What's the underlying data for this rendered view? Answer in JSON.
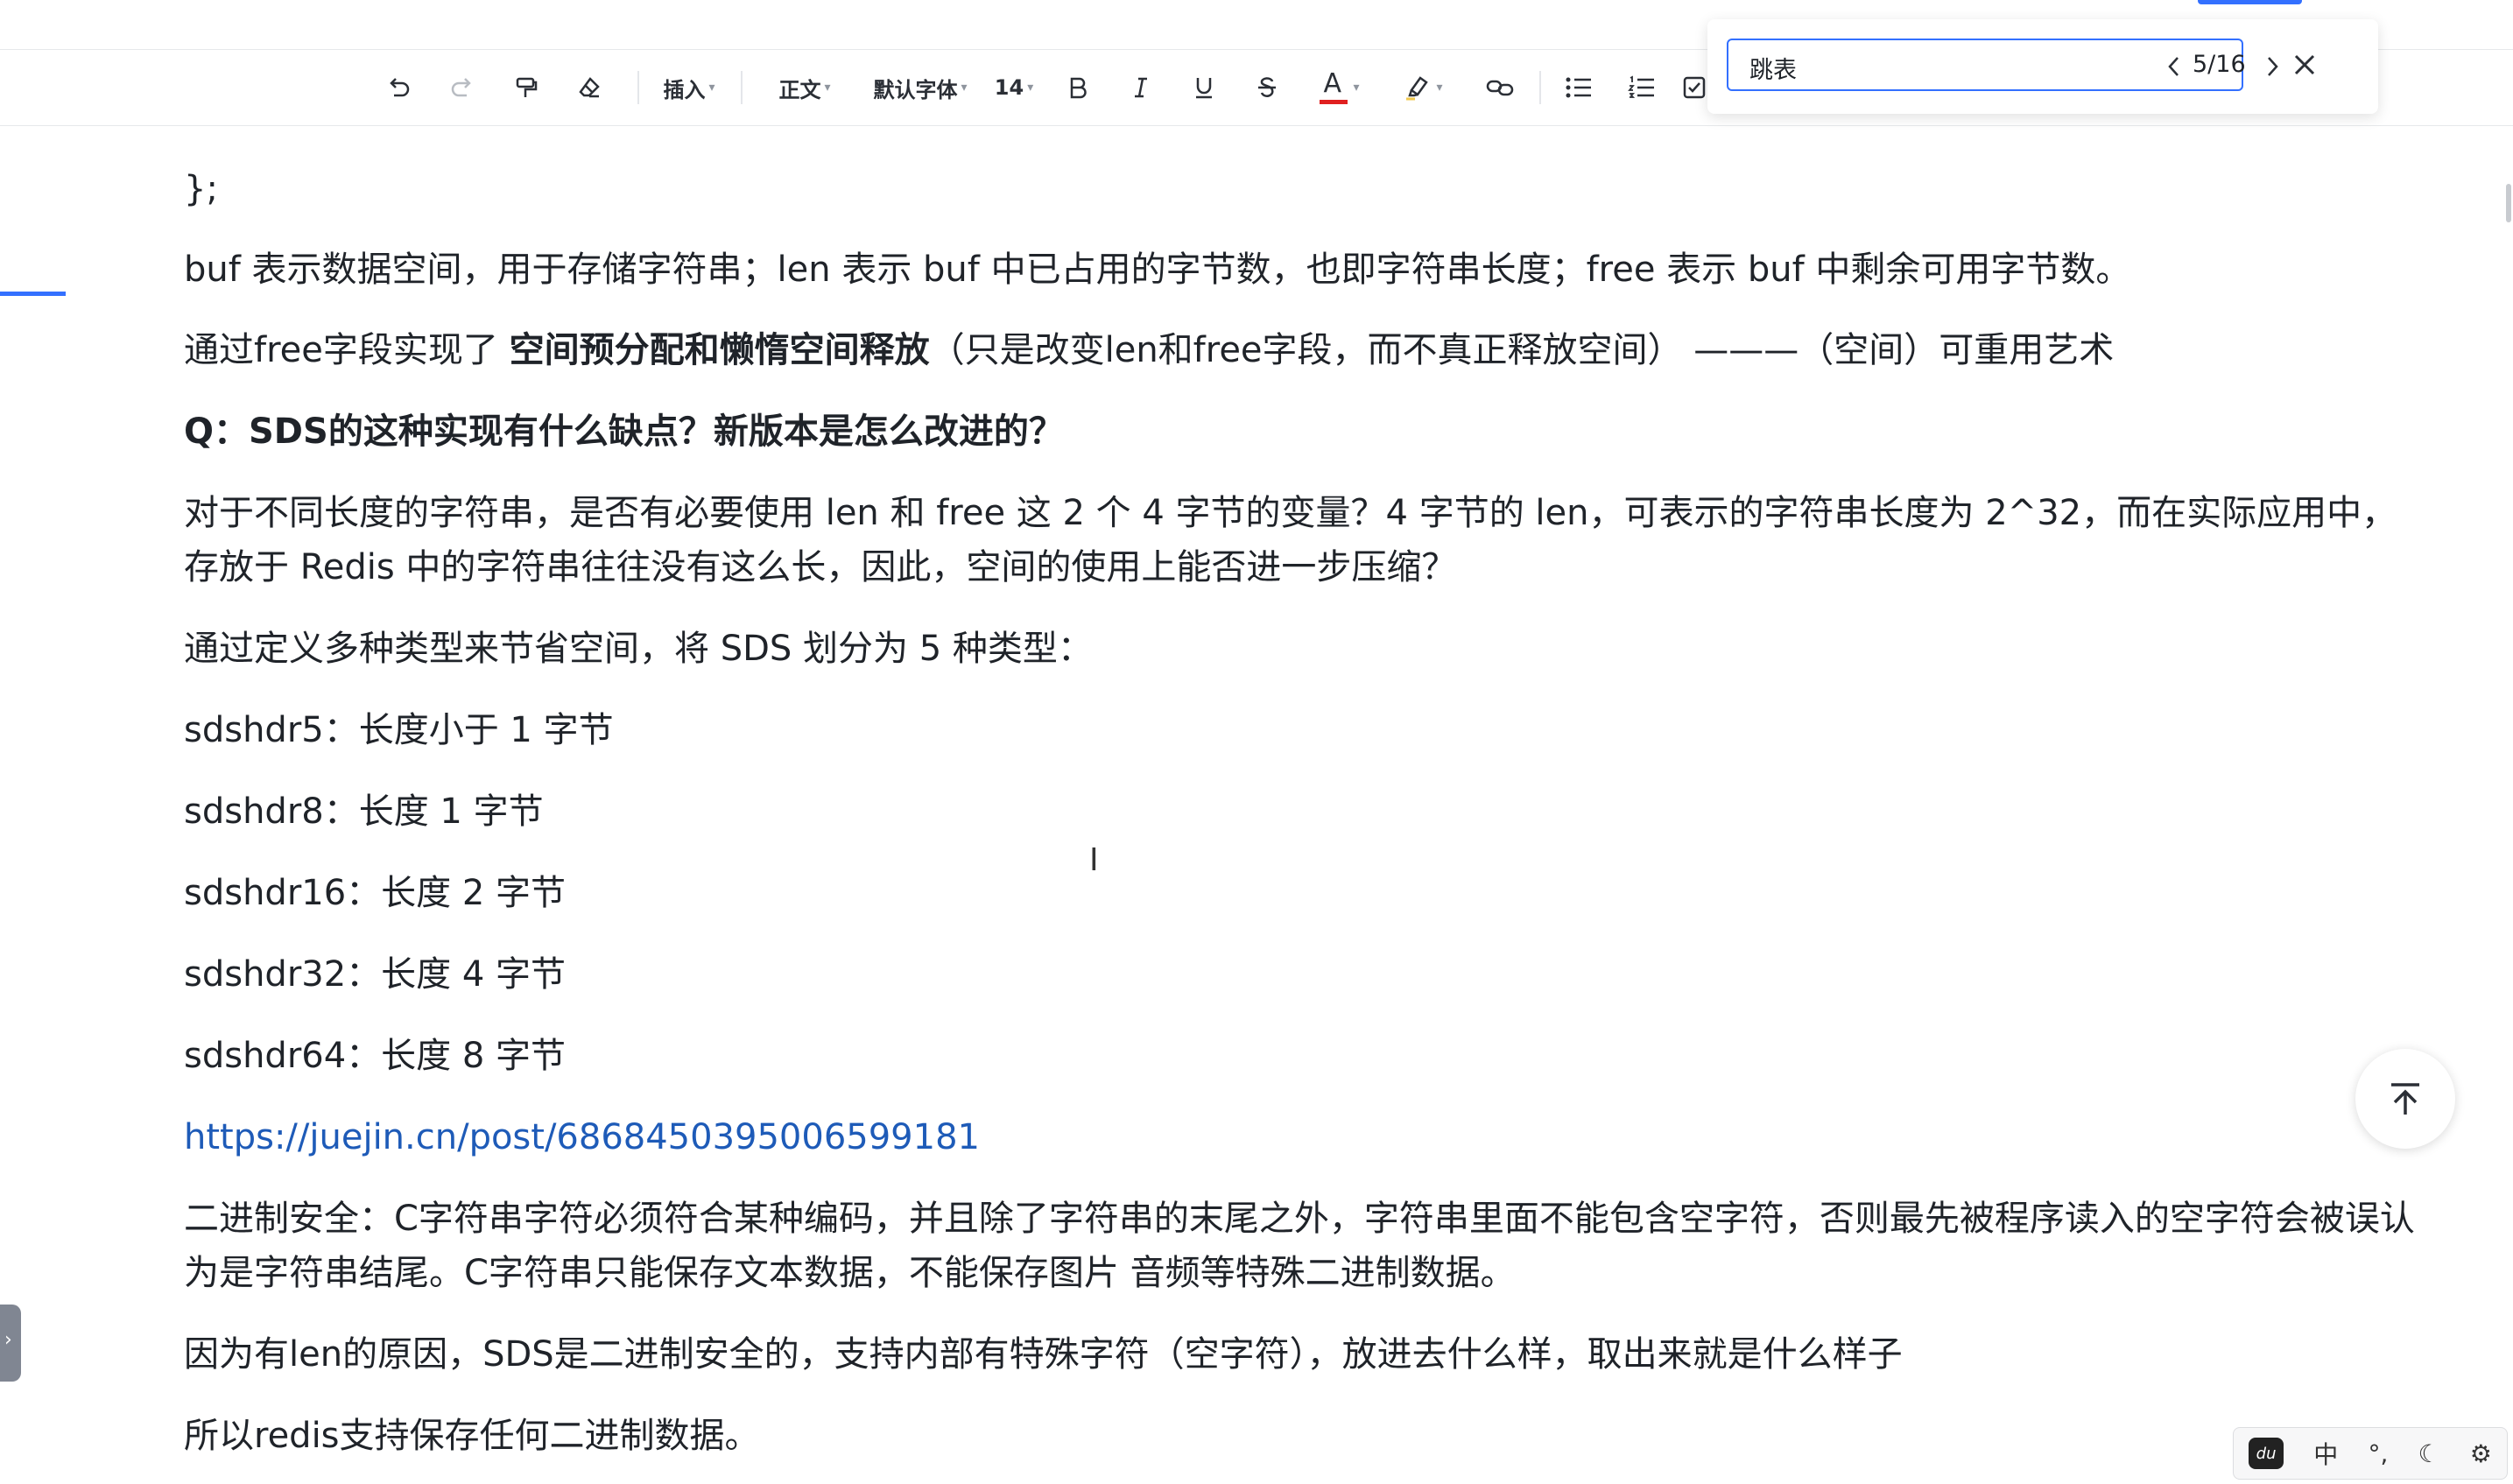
{
  "toolbar": {
    "insert_label": "插入",
    "style_label": "正文",
    "font_label": "默认字体",
    "size_label": "14",
    "font_color_glyph": "A",
    "text_color": "#e02020"
  },
  "find": {
    "query": "跳表",
    "count": "5/16"
  },
  "doc": {
    "line_code_end": "};",
    "p1": "buf 表示数据空间，用于存储字符串；len 表示 buf 中已占用的字节数，也即字符串长度；free 表示 buf 中剩余可用字节数。",
    "p2_prefix": "通过free字段实现了 ",
    "p2_bold": "空间预分配和懒惰空间释放",
    "p2_suffix": "（只是改变len和free字段，而不真正释放空间） ———（空间）可重用艺术",
    "q_heading": "Q：SDS的这种实现有什么缺点？新版本是怎么改进的？",
    "p3": "对于不同长度的字符串，是否有必要使用 len 和 free 这 2 个 4 字节的变量？4 字节的 len，可表示的字符串长度为 2^32，而在实际应用中，存放于 Redis 中的字符串往往没有这么长，因此，空间的使用上能否进一步压缩？",
    "p4": "通过定义多种类型来节省空间，将 SDS 划分为 5 种类型：",
    "types": [
      "sdshdr5：长度小于 1 字节",
      "sdshdr8：长度 1 字节",
      "sdshdr16：长度 2 字节",
      "sdshdr32：长度 4 字节",
      "sdshdr64：长度 8 字节"
    ],
    "link": "https://juejin.cn/post/6868450395006599181",
    "p5": "二进制安全：C字符串字符必须符合某种编码，并且除了字符串的末尾之外，字符串里面不能包含空字符，否则最先被程序读入的空字符会被误认为是字符串结尾。C字符串只能保存文本数据，不能保存图片 音频等特殊二进制数据。",
    "p6": "因为有len的原因，SDS是二进制安全的，支持内部有特殊字符（空字符），放进去什么样，取出来就是什么样子",
    "p7": "所以redis支持保存任何二进制数据。"
  },
  "ime": {
    "lang": "中",
    "punct": "°,"
  },
  "colors": {
    "accent": "#3370ff",
    "link": "#1e5bb8"
  }
}
